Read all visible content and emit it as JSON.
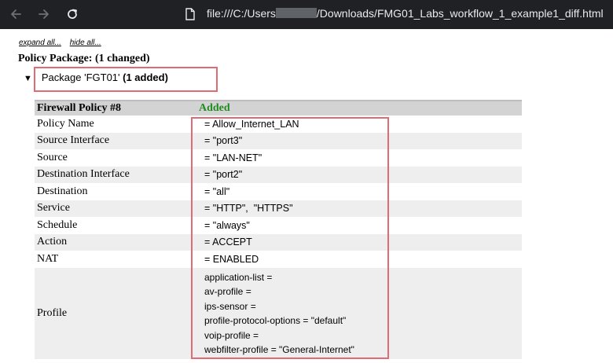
{
  "browser": {
    "url_prefix": "file:///C:/Users",
    "url_suffix": "/Downloads/FMG01_Labs_workflow_1_example1_diff.html"
  },
  "links": {
    "expand_all": "expand all...",
    "hide_all": "hide all..."
  },
  "package": {
    "title": "Policy Package: (1 changed)",
    "name": "Package 'FGT01'",
    "status": "(1 added)"
  },
  "policy": {
    "header": "Firewall Policy #8",
    "status": "Added",
    "rows": [
      {
        "key": "Policy Name",
        "value": "= Allow_Internet_LAN"
      },
      {
        "key": "Source Interface",
        "value": "= \"port3\""
      },
      {
        "key": "Source",
        "value": "= \"LAN-NET\""
      },
      {
        "key": "Destination Interface",
        "value": "= \"port2\""
      },
      {
        "key": "Destination",
        "value": "= \"all\""
      },
      {
        "key": "Service",
        "value": "= \"HTTP\",  \"HTTPS\""
      },
      {
        "key": "Schedule",
        "value": "= \"always\""
      },
      {
        "key": "Action",
        "value": "= ACCEPT"
      },
      {
        "key": "NAT",
        "value": "= ENABLED"
      }
    ],
    "profile": {
      "key": "Profile",
      "lines": [
        "application-list =",
        "av-profile =",
        "ips-sensor =",
        "profile-protocol-options = \"default\"",
        "voip-profile =",
        "webfilter-profile = \"General-Internet\""
      ]
    }
  },
  "colors": {
    "highlight": "#e06b74",
    "added": "#1e8c1e",
    "header_bg": "#d3d3d3",
    "alt_row_bg": "#eeeeee"
  }
}
